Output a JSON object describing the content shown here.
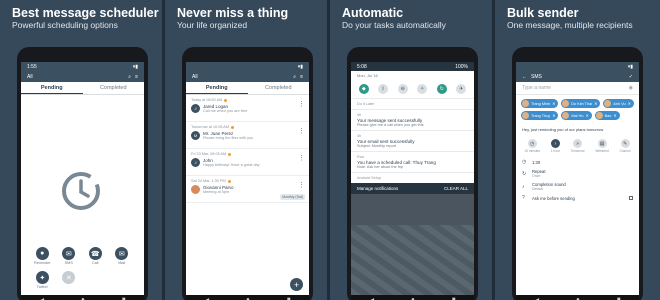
{
  "panels": [
    {
      "title": "Best message scheduler",
      "subtitle": "Powerful scheduling options",
      "status_time": "1:55",
      "filter": "All",
      "tabs": [
        "Pending",
        "Completed"
      ],
      "buttons": [
        {
          "label": "Reminder",
          "icon": "bell-icon"
        },
        {
          "label": "SMS",
          "icon": "sms-icon"
        },
        {
          "label": "Call",
          "icon": "phone-icon"
        },
        {
          "label": "Mail",
          "icon": "mail-icon"
        },
        {
          "label": "Twitter",
          "icon": "twitter-icon"
        },
        {
          "label": "",
          "icon": "close-icon"
        }
      ]
    },
    {
      "title": "Never miss a thing",
      "subtitle": "Your life organized",
      "filter": "All",
      "tabs": [
        "Pending",
        "Completed"
      ],
      "items": [
        {
          "meta": "Today at 08:52 AM",
          "name": "Jared Logan",
          "msg": "Call me when you are free",
          "chip": ""
        },
        {
          "meta": "Tomorrow at 10:08 AM",
          "name": "Mr. Juan Perez",
          "msg": "Please bring the files with you",
          "chip": ""
        },
        {
          "meta": "Fri 23 Mar, 09:05 AM",
          "name": "John",
          "msg": "Happy birthday! Have a great day",
          "chip": ""
        },
        {
          "meta": "Sat 24 Mar, 1:30 PM",
          "name": "Giovanni Paino",
          "msg": "Meeting at 5pm",
          "chip": "Monthly (Sat)"
        }
      ],
      "fab": "+"
    },
    {
      "title": "Automatic",
      "subtitle": "Do your tasks automatically",
      "status_time": "5:08",
      "battery": "100%",
      "date": "Mon, Jul 16",
      "notifications": [
        {
          "header": "Do it Later",
          "title": "",
          "sub": ""
        },
        {
          "header": "4h",
          "title": "Your message sent successfully",
          "sub": "Please give me a call when you get this"
        },
        {
          "header": "4h",
          "title": "Your email sent successfully",
          "sub": "Subject: Monthly report"
        },
        {
          "header": "Run",
          "title": "You have a scheduled call: Thuy Trang",
          "sub": "Note: Ask her about the trip"
        },
        {
          "header": "Android Setup",
          "title": "",
          "sub": ""
        }
      ],
      "footer_left": "Manage notifications",
      "footer_right": "CLEAR ALL"
    },
    {
      "title": "Bulk sender",
      "subtitle": "One message, multiple recipients",
      "screen_title": "SMS",
      "contact_placeholder": "Type a name",
      "recipients": [
        "Trang Minh",
        "Do Kim Thai",
        "Anh Vu",
        "Trang Thuy",
        "Mai Ho",
        "Bao"
      ],
      "message": "Hey, just reminding you of our plans tomorrow",
      "schedule_options": [
        "15 minutes",
        "1 hour",
        "Tomorrow",
        "Weekend",
        "Custom"
      ],
      "options": [
        {
          "a": "1:30",
          "b": ""
        },
        {
          "a": "Repeat",
          "b": "Once"
        },
        {
          "a": "Completion sound",
          "b": "Default"
        },
        {
          "a": "Ask me before sending",
          "b": ""
        }
      ]
    }
  ]
}
